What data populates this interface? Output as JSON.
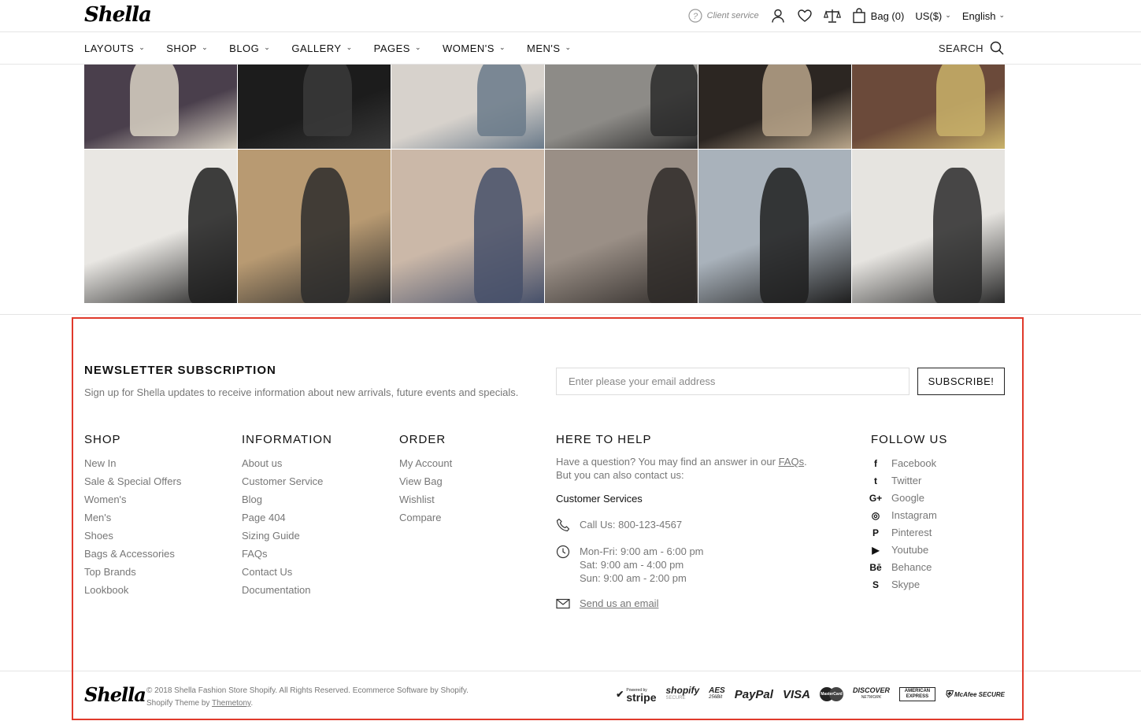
{
  "brand": {
    "name": "Shella"
  },
  "topbar": {
    "client_service": "Client service",
    "bag_label": "Bag (0)",
    "currency": "US($)",
    "language": "English"
  },
  "nav": {
    "items": [
      "LAYOUTS",
      "SHOP",
      "BLOG",
      "GALLERY",
      "PAGES",
      "WOMEN'S",
      "MEN'S"
    ],
    "search_label": "SEARCH"
  },
  "newsletter": {
    "title": "NEWSLETTER SUBSCRIPTION",
    "description": "Sign up for Shella updates to receive information about new arrivals, future events and specials.",
    "placeholder": "Enter please your email address",
    "button": "SUBSCRIBE!"
  },
  "footer": {
    "shop": {
      "title": "SHOP",
      "links": [
        "New In",
        "Sale & Special Offers",
        "Women's",
        "Men's",
        "Shoes",
        "Bags & Accessories",
        "Top Brands",
        "Lookbook"
      ]
    },
    "information": {
      "title": "INFORMATION",
      "links": [
        "About us",
        "Customer Service",
        "Blog",
        "Page 404",
        "Sizing Guide",
        "FAQs",
        "Contact Us",
        "Documentation"
      ]
    },
    "order": {
      "title": "ORDER",
      "links": [
        "My Account",
        "View Bag",
        "Wishlist",
        "Compare"
      ]
    },
    "help": {
      "title": "HERE TO HELP",
      "text_before": "Have a question? You may find an answer in our ",
      "faq_link": "FAQs",
      "text_after": ".",
      "text_line2": "But you can also contact us:",
      "subtitle": "Customer Services",
      "phone": "Call Us: 800-123-4567",
      "hours": [
        "Mon-Fri: 9:00 am - 6:00 pm",
        "Sat: 9:00 am - 4:00 pm",
        "Sun: 9:00 am - 2:00 pm"
      ],
      "email_link": "Send us an email"
    },
    "follow": {
      "title": "FOLLOW US",
      "items": [
        {
          "label": "Facebook",
          "icon": "facebook-icon",
          "glyph": "f"
        },
        {
          "label": "Twitter",
          "icon": "twitter-icon",
          "glyph": "t"
        },
        {
          "label": "Google",
          "icon": "google-plus-icon",
          "glyph": "G+"
        },
        {
          "label": "Instagram",
          "icon": "instagram-icon",
          "glyph": "◎"
        },
        {
          "label": "Pinterest",
          "icon": "pinterest-icon",
          "glyph": "P"
        },
        {
          "label": "Youtube",
          "icon": "youtube-icon",
          "glyph": "▶"
        },
        {
          "label": "Behance",
          "icon": "behance-icon",
          "glyph": "Bē"
        },
        {
          "label": "Skype",
          "icon": "skype-icon",
          "glyph": "S"
        }
      ]
    }
  },
  "bottom": {
    "copyright": "© 2018 Shella Fashion Store Shopify. All Rights Reserved. Ecommerce Software by Shopify.",
    "theme_prefix": "Shopify Theme by ",
    "theme_link": "Themetony",
    "theme_suffix": ".",
    "payments": [
      "stripe",
      "shopify",
      "AES",
      "PayPal",
      "VISA",
      "MasterCard",
      "DISCOVER",
      "AMERICAN EXPRESS",
      "McAfee SECURE"
    ],
    "payment_badges": {
      "stripe_note": "Powered by",
      "shopify_note": "SECURE",
      "aes_note": "256Bit",
      "discover_note": "NETWORK",
      "mcafee_note": "SECURE"
    }
  },
  "colors": {
    "accent_frame": "#e0392b",
    "text_dark": "#111111",
    "text_muted": "#777777"
  }
}
